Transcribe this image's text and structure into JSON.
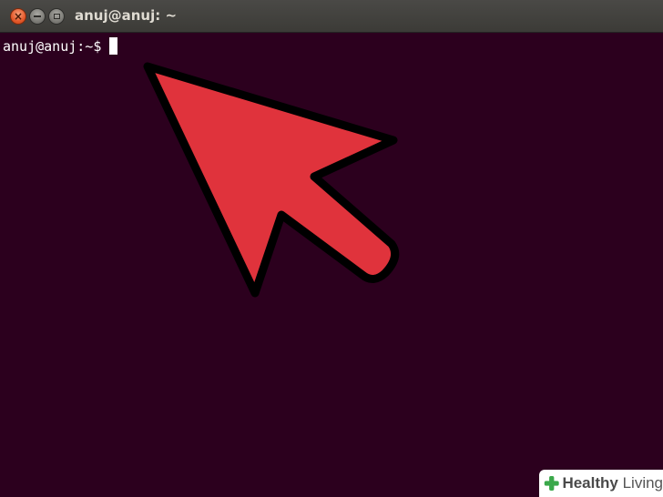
{
  "window": {
    "title": "anuj@anuj: ~",
    "buttons": {
      "close": "×"
    }
  },
  "terminal": {
    "prompt": "anuj@anuj:~$",
    "background": "#2c001e",
    "text_color": "#ffffff"
  },
  "overlay": {
    "arrow_icon": "arrow-pointer-icon",
    "arrow_fill": "#e0333c",
    "arrow_stroke": "#000000"
  },
  "watermark": {
    "brand_bold": "Healthy",
    "brand_light": " Living",
    "icon": "plus-leaf-icon",
    "color": "#3aa84a"
  }
}
